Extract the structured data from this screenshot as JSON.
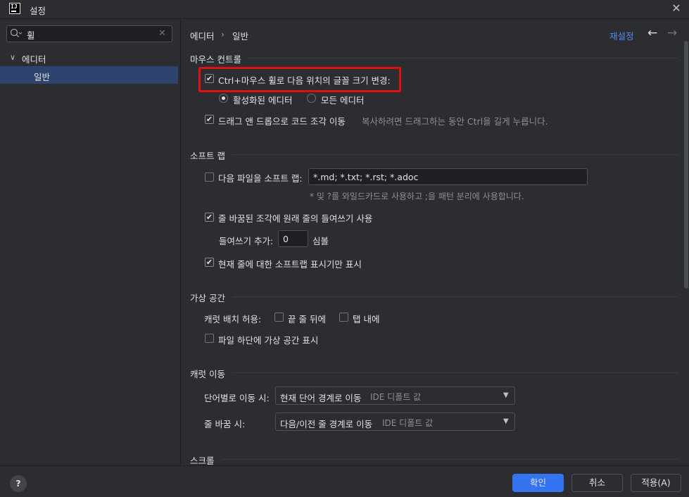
{
  "window": {
    "title": "설정",
    "app_icon_text": "IJ"
  },
  "search": {
    "value": "휠"
  },
  "tree": {
    "editor": "에디터",
    "general": "일반"
  },
  "breadcrumb": {
    "part1": "에디터",
    "separator": "›",
    "part2": "일반"
  },
  "header": {
    "reset": "재설정",
    "back": "←",
    "forward": "→"
  },
  "mouse_control": {
    "title": "마우스 컨트롤",
    "ctrl_wheel_label": "Ctrl+마우스 휠로 다음 위치의 글꼴 크기 변경:",
    "ctrl_wheel_checked": true,
    "radio_active_editor": "활성화된 에디터",
    "radio_all_editors": "모든 에디터",
    "drag_drop_label": "드래그 앤 드롭으로 코드 조각 이동",
    "drag_drop_checked": true,
    "drag_drop_hint": "복사하려면 드래그하는 동안 Ctrl을 길게 누릅니다."
  },
  "soft_wraps": {
    "title": "소프트 랩",
    "files_label": "다음 파일을 소프트 랩:",
    "files_value": "*.md; *.txt; *.rst; *.adoc",
    "files_hint": "* 및 ?를 와일드카드로 사용하고 ;을 패턴 분리에 사용합니다.",
    "indent_label": "줄 바꿈된 조각에 원래 줄의 들여쓰기 사용",
    "extra_indent_label": "들여쓰기 추가:",
    "extra_indent_value": "0",
    "extra_indent_unit": "심볼",
    "current_line_label": "현재 줄에 대한 소프트랩 표시기만 표시"
  },
  "virtual_space": {
    "title": "가상 공간",
    "caret_allow_label": "캐럿 배치 허용:",
    "end_of_line": "끝 줄 뒤에",
    "inside_tabs": "탭 내에",
    "show_bottom": "파일 하단에 가상 공간 표시"
  },
  "caret_movement": {
    "title": "캐럿 이동",
    "word_label": "단어별로 이동 시:",
    "word_value": "현재 단어 경계로 이동",
    "word_hint": "IDE 디폴트 값",
    "line_label": "줄 바꿈 시:",
    "line_value": "다음/이전 줄 경계로 이동",
    "line_hint": "IDE 디폴트 값"
  },
  "scrolling": {
    "title": "스크롤"
  },
  "footer": {
    "help": "?",
    "ok": "확인",
    "cancel": "취소",
    "apply": "적용(A)"
  }
}
